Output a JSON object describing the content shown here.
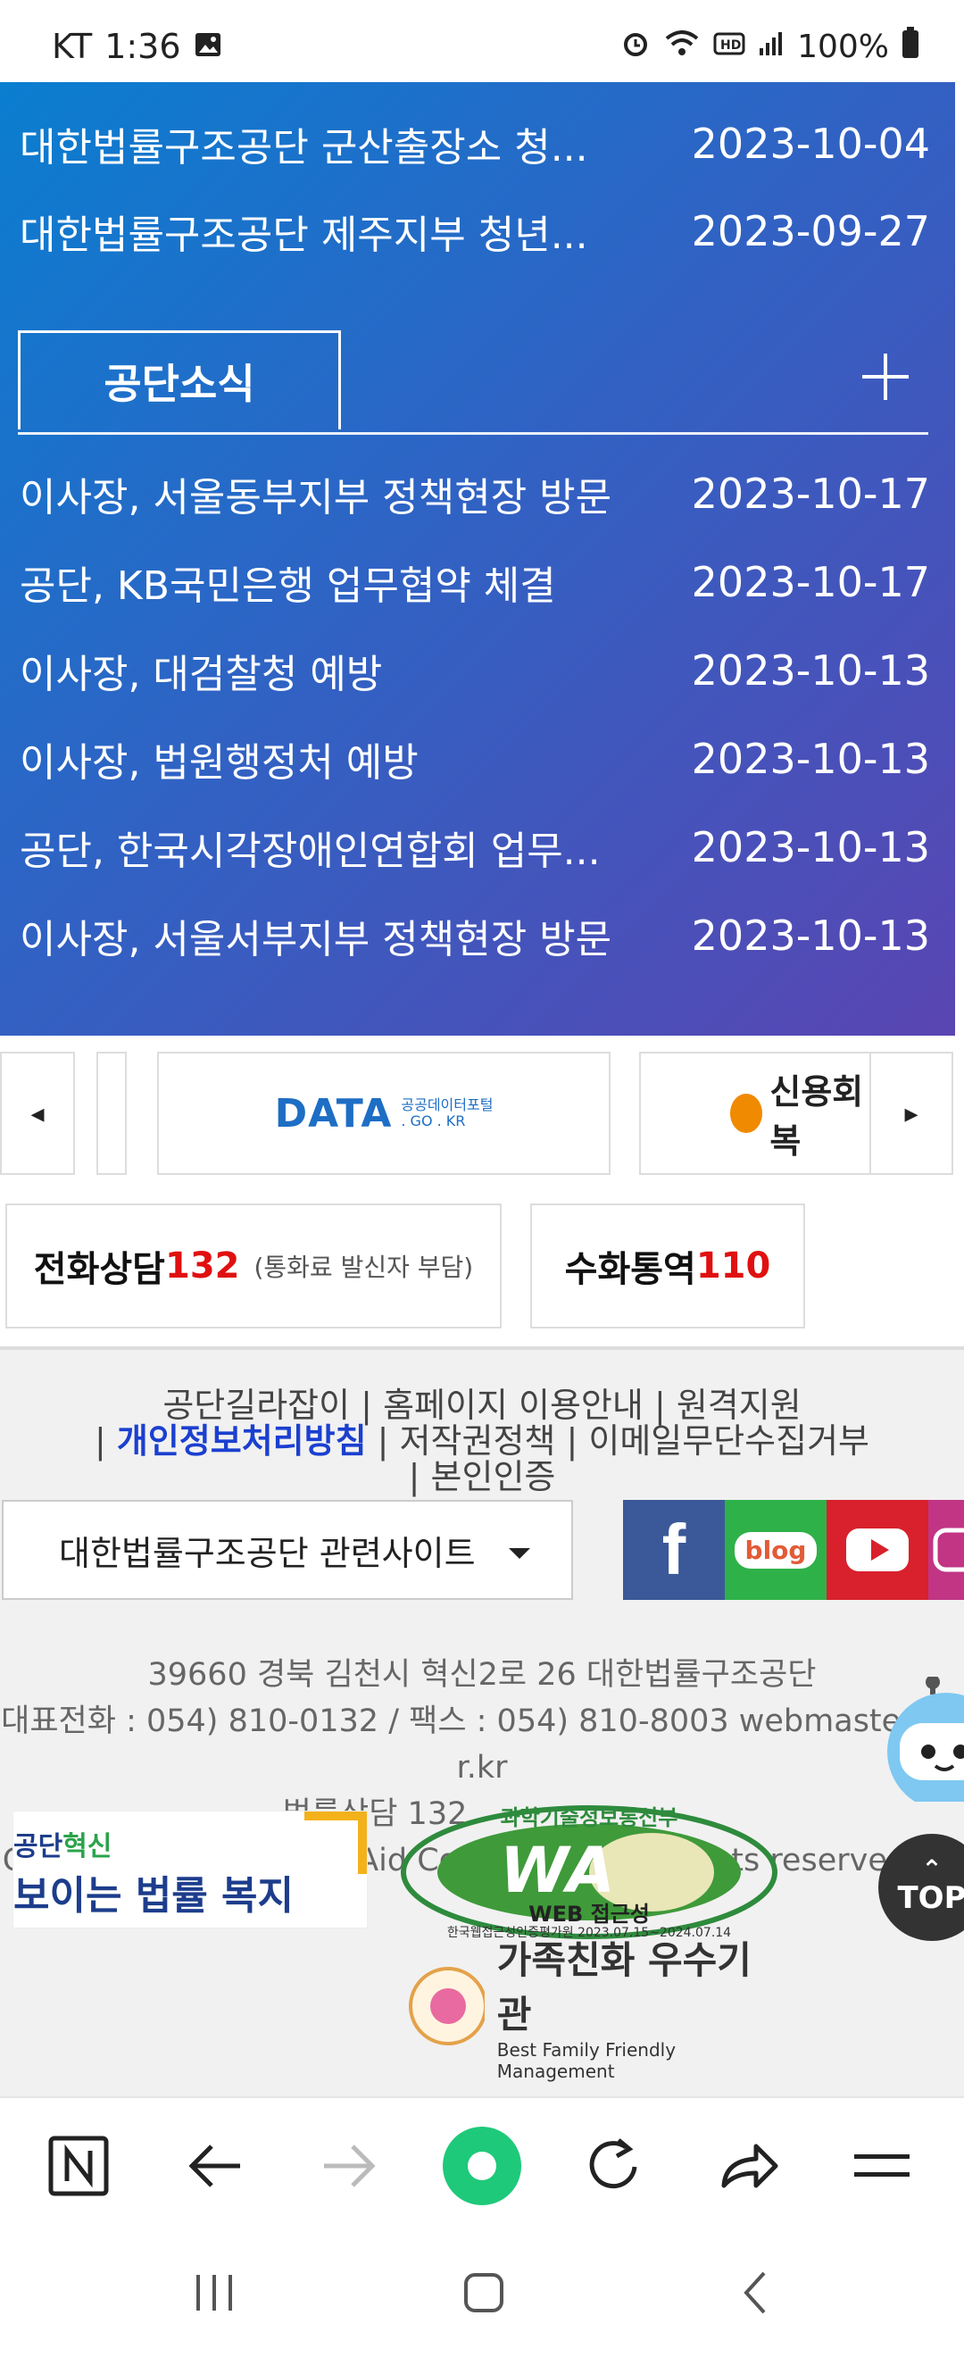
{
  "status_bar": {
    "carrier": "KT",
    "time": "1:36",
    "battery": "100%"
  },
  "notices": [
    {
      "title": "대한법률구조공단 군산출장소 청...",
      "date": "2023-10-04"
    },
    {
      "title": "대한법률구조공단 제주지부 청년...",
      "date": "2023-09-27"
    }
  ],
  "news_tab": {
    "label": "공단소식"
  },
  "news": [
    {
      "title": "이사장, 서울동부지부 정책현장 방문",
      "date": "2023-10-17"
    },
    {
      "title": "공단, KB국민은행 업무협약 체결",
      "date": "2023-10-17"
    },
    {
      "title": "이사장, 대검찰청 예방",
      "date": "2023-10-13"
    },
    {
      "title": "이사장, 법원행정처 예방",
      "date": "2023-10-13"
    },
    {
      "title": "공단, 한국시각장애인연합회 업무...",
      "date": "2023-10-13"
    },
    {
      "title": "이사장, 서울서부지부 정책현장 방문",
      "date": "2023-10-13"
    }
  ],
  "banners": {
    "data_logo": "DATA",
    "data_sub1": "공공데이터포털",
    "data_sub2": ". GO . KR",
    "credit_label": "신용회복"
  },
  "phone": {
    "consult_label": "전화상담",
    "consult_number": "132",
    "consult_note": "(통화료 발신자 부담)",
    "sign_label": "수화통역",
    "sign_number": "110"
  },
  "footer_links": {
    "l1": "공단길라잡이",
    "l2": "홈페이지 이용안내",
    "l3": "원격지원",
    "l4": "개인정보처리방침",
    "l5": "저작권정책",
    "l6": "이메일무단수집거부",
    "l7": "본인인증",
    "sep": "|"
  },
  "related_sites": {
    "label": "대한법률구조공단 관련사이트"
  },
  "social": {
    "facebook": "f",
    "blog": "blog"
  },
  "address": {
    "line1": "39660 경북 김천시 혁신2로 26 대한법률구조공단",
    "line2": "대표전화 : 054) 810-0132 / 팩스 : 054) 810-8003 webmaster@k",
    "line3": "r.kr",
    "line4": "법률상담 132",
    "copyright": "Copyright Korea Legal Aid Corporation. All rights reserved."
  },
  "badges": {
    "innov_top": "공단",
    "innov_top_hl": "혁신",
    "innov_bottom": "보이는 법률 복지",
    "wa_top": "과학기술정보통신부",
    "wa_mark": "WA",
    "wa_label": "WEB 접근성",
    "wa_cert": "한국웹접근성인증평가원 2023.07.15~2024.07.14",
    "family_title": "가족친화 우수기관",
    "family_sub": "Best Family Friendly Management"
  },
  "top_button": {
    "label": "TOP"
  },
  "colors": {
    "panel_start": "#0a7ed0",
    "panel_end": "#5a45b2",
    "accent_red": "#e01010",
    "link_blue": "#1b3fd0",
    "whale_green": "#1ec97a"
  }
}
